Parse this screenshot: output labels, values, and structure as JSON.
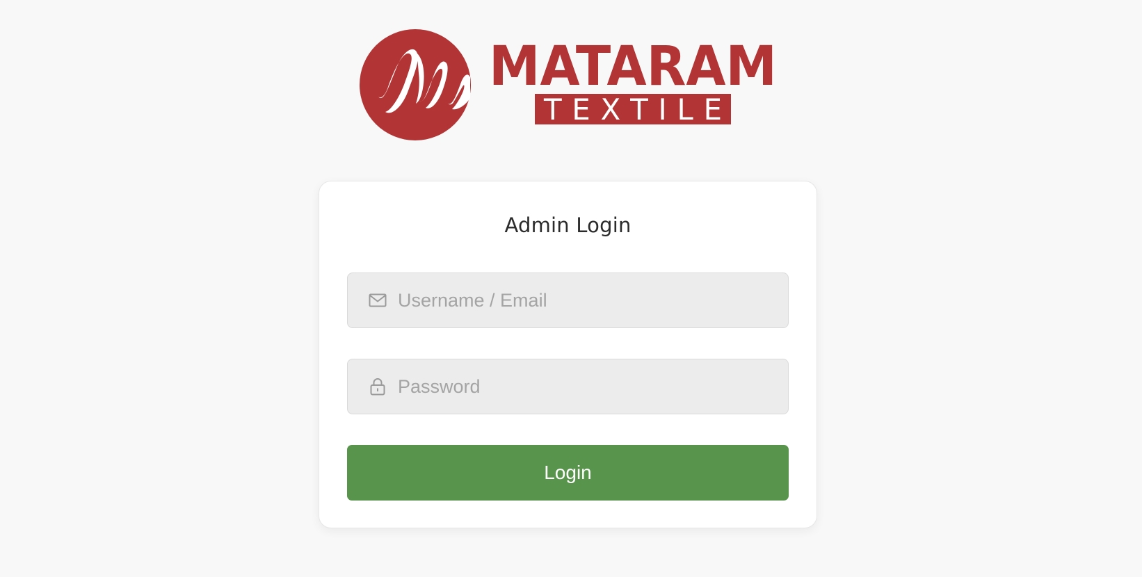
{
  "brand": {
    "name": "MATARAM",
    "tagline": "TEXTILE",
    "color": "#b23434"
  },
  "login": {
    "title": "Admin Login",
    "username": {
      "placeholder": "Username / Email",
      "value": "",
      "icon": "envelope-icon"
    },
    "password": {
      "placeholder": "Password",
      "value": "",
      "icon": "lock-icon"
    },
    "submit_label": "Login",
    "submit_color": "#58944b"
  }
}
